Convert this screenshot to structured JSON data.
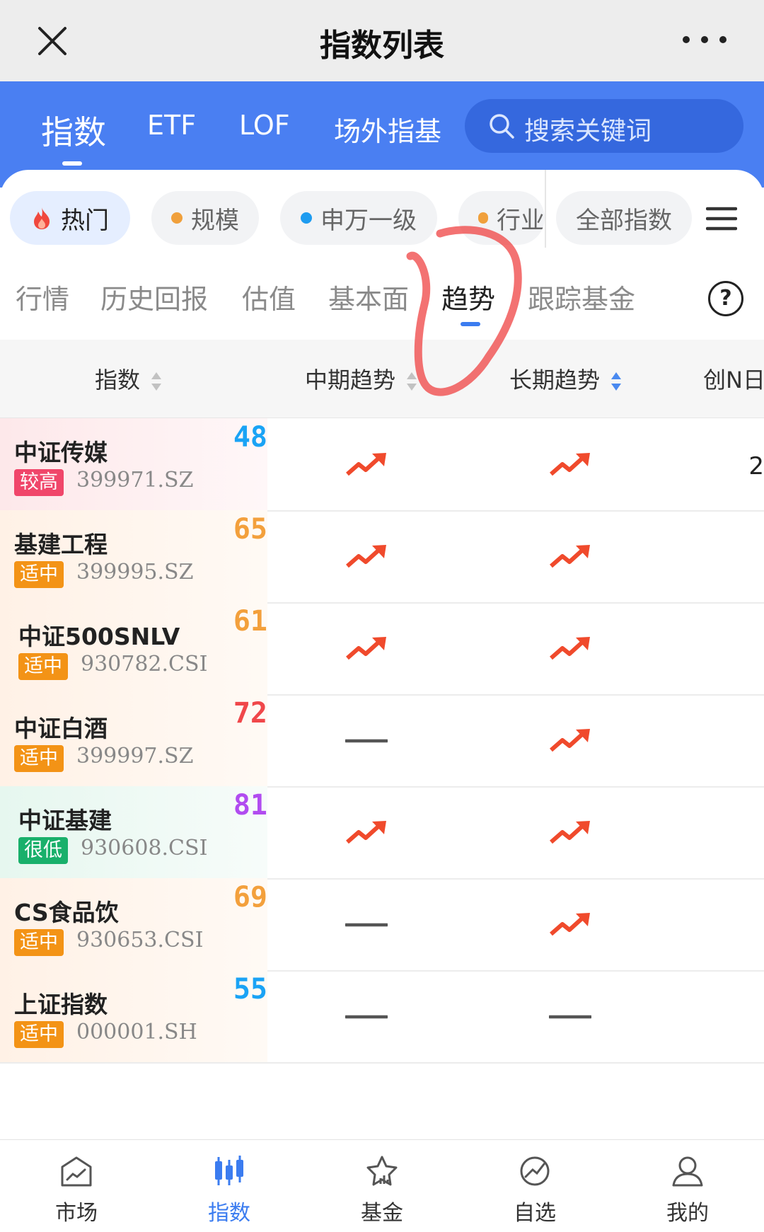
{
  "header": {
    "title": "指数列表"
  },
  "tabs": [
    {
      "label": "指数"
    },
    {
      "label": "ETF"
    },
    {
      "label": "LOF"
    },
    {
      "label": "场外指基"
    }
  ],
  "search": {
    "placeholder": "搜索关键词"
  },
  "chips": [
    {
      "label": "热门"
    },
    {
      "label": "规模"
    },
    {
      "label": "申万一级"
    },
    {
      "label": "行业"
    },
    {
      "label": "全部指数"
    }
  ],
  "subtabs": [
    {
      "label": "行情"
    },
    {
      "label": "历史回报"
    },
    {
      "label": "估值"
    },
    {
      "label": "基本面"
    },
    {
      "label": "趋势"
    },
    {
      "label": "跟踪基金"
    }
  ],
  "columns": {
    "index": "指数",
    "mid": "中期趋势",
    "long": "长期趋势",
    "newhigh": "创N日"
  },
  "rows": [
    {
      "name": "中证传媒",
      "badge": "较高",
      "code": "399971.SZ",
      "score": "48",
      "mid": "up",
      "long": "up",
      "extra": "2"
    },
    {
      "name": "基建工程",
      "badge": "适中",
      "code": "399995.SZ",
      "score": "65",
      "mid": "up",
      "long": "up",
      "extra": ""
    },
    {
      "name": "中证500SNLV",
      "badge": "适中",
      "code": "930782.CSI",
      "score": "61",
      "mid": "up",
      "long": "up",
      "extra": ""
    },
    {
      "name": "中证白酒",
      "badge": "适中",
      "code": "399997.SZ",
      "score": "72",
      "mid": "flat",
      "long": "up",
      "extra": ""
    },
    {
      "name": "中证基建",
      "badge": "很低",
      "code": "930608.CSI",
      "score": "81",
      "mid": "up",
      "long": "up",
      "extra": ""
    },
    {
      "name": "CS食品饮",
      "badge": "适中",
      "code": "930653.CSI",
      "score": "69",
      "mid": "flat",
      "long": "up",
      "extra": ""
    },
    {
      "name": "上证指数",
      "badge": "适中",
      "code": "000001.SH",
      "score": "55",
      "mid": "flat",
      "long": "flat",
      "extra": ""
    }
  ],
  "bottom_nav": [
    {
      "label": "市场"
    },
    {
      "label": "指数"
    },
    {
      "label": "基金"
    },
    {
      "label": "自选"
    },
    {
      "label": "我的"
    }
  ]
}
